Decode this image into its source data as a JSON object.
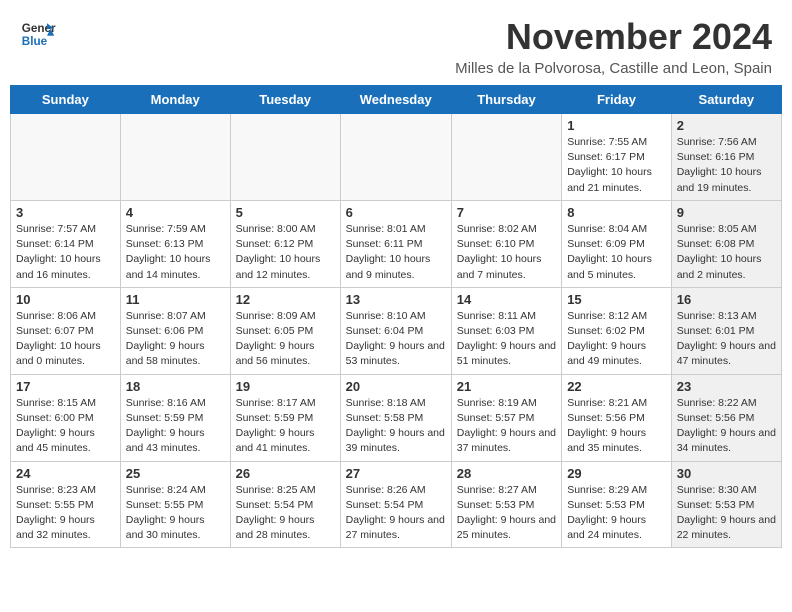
{
  "header": {
    "logo_general": "General",
    "logo_blue": "Blue",
    "title": "November 2024",
    "location": "Milles de la Polvorosa, Castille and Leon, Spain"
  },
  "days_of_week": [
    "Sunday",
    "Monday",
    "Tuesday",
    "Wednesday",
    "Thursday",
    "Friday",
    "Saturday"
  ],
  "weeks": [
    [
      {
        "day": "",
        "info": "",
        "shaded": false
      },
      {
        "day": "",
        "info": "",
        "shaded": false
      },
      {
        "day": "",
        "info": "",
        "shaded": false
      },
      {
        "day": "",
        "info": "",
        "shaded": false
      },
      {
        "day": "",
        "info": "",
        "shaded": false
      },
      {
        "day": "1",
        "info": "Sunrise: 7:55 AM\nSunset: 6:17 PM\nDaylight: 10 hours and 21 minutes.",
        "shaded": false
      },
      {
        "day": "2",
        "info": "Sunrise: 7:56 AM\nSunset: 6:16 PM\nDaylight: 10 hours and 19 minutes.",
        "shaded": true
      }
    ],
    [
      {
        "day": "3",
        "info": "Sunrise: 7:57 AM\nSunset: 6:14 PM\nDaylight: 10 hours and 16 minutes.",
        "shaded": false
      },
      {
        "day": "4",
        "info": "Sunrise: 7:59 AM\nSunset: 6:13 PM\nDaylight: 10 hours and 14 minutes.",
        "shaded": false
      },
      {
        "day": "5",
        "info": "Sunrise: 8:00 AM\nSunset: 6:12 PM\nDaylight: 10 hours and 12 minutes.",
        "shaded": false
      },
      {
        "day": "6",
        "info": "Sunrise: 8:01 AM\nSunset: 6:11 PM\nDaylight: 10 hours and 9 minutes.",
        "shaded": false
      },
      {
        "day": "7",
        "info": "Sunrise: 8:02 AM\nSunset: 6:10 PM\nDaylight: 10 hours and 7 minutes.",
        "shaded": false
      },
      {
        "day": "8",
        "info": "Sunrise: 8:04 AM\nSunset: 6:09 PM\nDaylight: 10 hours and 5 minutes.",
        "shaded": false
      },
      {
        "day": "9",
        "info": "Sunrise: 8:05 AM\nSunset: 6:08 PM\nDaylight: 10 hours and 2 minutes.",
        "shaded": true
      }
    ],
    [
      {
        "day": "10",
        "info": "Sunrise: 8:06 AM\nSunset: 6:07 PM\nDaylight: 10 hours and 0 minutes.",
        "shaded": false
      },
      {
        "day": "11",
        "info": "Sunrise: 8:07 AM\nSunset: 6:06 PM\nDaylight: 9 hours and 58 minutes.",
        "shaded": false
      },
      {
        "day": "12",
        "info": "Sunrise: 8:09 AM\nSunset: 6:05 PM\nDaylight: 9 hours and 56 minutes.",
        "shaded": false
      },
      {
        "day": "13",
        "info": "Sunrise: 8:10 AM\nSunset: 6:04 PM\nDaylight: 9 hours and 53 minutes.",
        "shaded": false
      },
      {
        "day": "14",
        "info": "Sunrise: 8:11 AM\nSunset: 6:03 PM\nDaylight: 9 hours and 51 minutes.",
        "shaded": false
      },
      {
        "day": "15",
        "info": "Sunrise: 8:12 AM\nSunset: 6:02 PM\nDaylight: 9 hours and 49 minutes.",
        "shaded": false
      },
      {
        "day": "16",
        "info": "Sunrise: 8:13 AM\nSunset: 6:01 PM\nDaylight: 9 hours and 47 minutes.",
        "shaded": true
      }
    ],
    [
      {
        "day": "17",
        "info": "Sunrise: 8:15 AM\nSunset: 6:00 PM\nDaylight: 9 hours and 45 minutes.",
        "shaded": false
      },
      {
        "day": "18",
        "info": "Sunrise: 8:16 AM\nSunset: 5:59 PM\nDaylight: 9 hours and 43 minutes.",
        "shaded": false
      },
      {
        "day": "19",
        "info": "Sunrise: 8:17 AM\nSunset: 5:59 PM\nDaylight: 9 hours and 41 minutes.",
        "shaded": false
      },
      {
        "day": "20",
        "info": "Sunrise: 8:18 AM\nSunset: 5:58 PM\nDaylight: 9 hours and 39 minutes.",
        "shaded": false
      },
      {
        "day": "21",
        "info": "Sunrise: 8:19 AM\nSunset: 5:57 PM\nDaylight: 9 hours and 37 minutes.",
        "shaded": false
      },
      {
        "day": "22",
        "info": "Sunrise: 8:21 AM\nSunset: 5:56 PM\nDaylight: 9 hours and 35 minutes.",
        "shaded": false
      },
      {
        "day": "23",
        "info": "Sunrise: 8:22 AM\nSunset: 5:56 PM\nDaylight: 9 hours and 34 minutes.",
        "shaded": true
      }
    ],
    [
      {
        "day": "24",
        "info": "Sunrise: 8:23 AM\nSunset: 5:55 PM\nDaylight: 9 hours and 32 minutes.",
        "shaded": false
      },
      {
        "day": "25",
        "info": "Sunrise: 8:24 AM\nSunset: 5:55 PM\nDaylight: 9 hours and 30 minutes.",
        "shaded": false
      },
      {
        "day": "26",
        "info": "Sunrise: 8:25 AM\nSunset: 5:54 PM\nDaylight: 9 hours and 28 minutes.",
        "shaded": false
      },
      {
        "day": "27",
        "info": "Sunrise: 8:26 AM\nSunset: 5:54 PM\nDaylight: 9 hours and 27 minutes.",
        "shaded": false
      },
      {
        "day": "28",
        "info": "Sunrise: 8:27 AM\nSunset: 5:53 PM\nDaylight: 9 hours and 25 minutes.",
        "shaded": false
      },
      {
        "day": "29",
        "info": "Sunrise: 8:29 AM\nSunset: 5:53 PM\nDaylight: 9 hours and 24 minutes.",
        "shaded": false
      },
      {
        "day": "30",
        "info": "Sunrise: 8:30 AM\nSunset: 5:53 PM\nDaylight: 9 hours and 22 minutes.",
        "shaded": true
      }
    ]
  ]
}
